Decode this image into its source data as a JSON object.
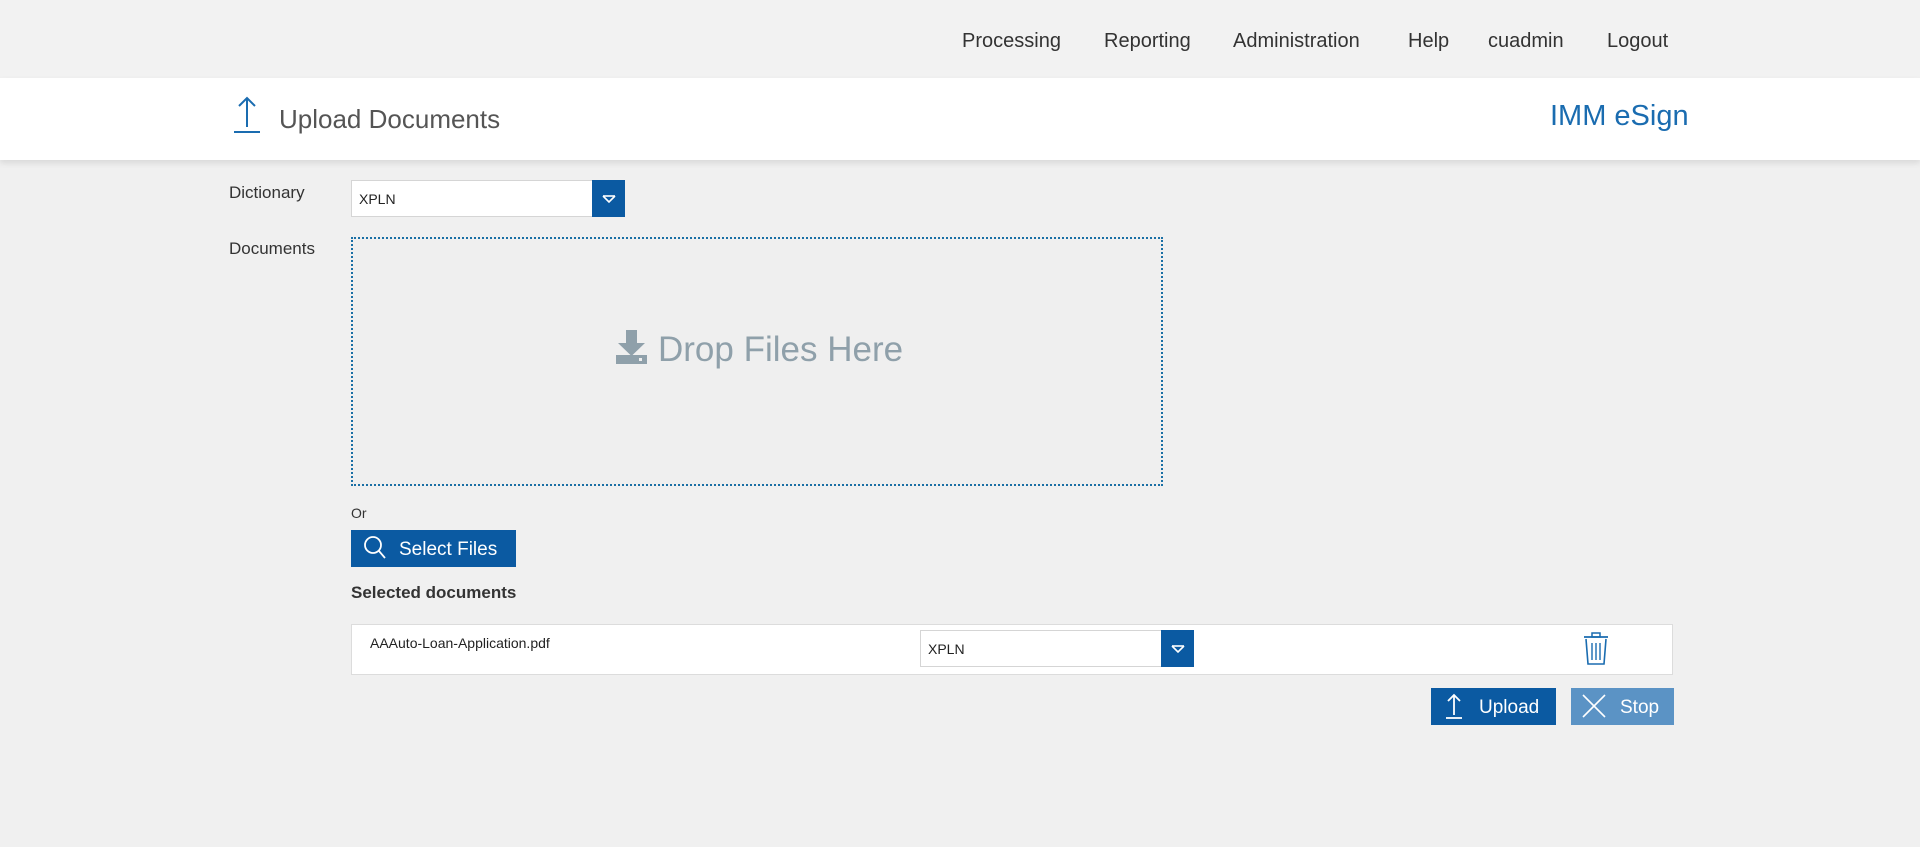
{
  "nav": {
    "items": [
      "Processing",
      "Reporting",
      "Administration",
      "Help",
      "cuadmin",
      "Logout"
    ]
  },
  "header": {
    "title": "Upload Documents",
    "brand": "IMM eSign",
    "icon": "upload-arrow-icon"
  },
  "form": {
    "dictionary_label": "Dictionary",
    "dictionary_value": "XPLN",
    "documents_label": "Documents",
    "drop_text": "Drop Files Here",
    "or_text": "Or",
    "select_files_label": "Select Files"
  },
  "selected": {
    "title": "Selected documents",
    "documents": [
      {
        "name": "AAAuto-Loan-Application.pdf",
        "dictionary": "XPLN"
      }
    ]
  },
  "actions": {
    "upload_label": "Upload",
    "stop_label": "Stop"
  },
  "colors": {
    "accent": "#0b5aa2",
    "brand": "#1a6cb0",
    "stop": "#5b93c5",
    "drop_text": "#8fa0aa"
  }
}
